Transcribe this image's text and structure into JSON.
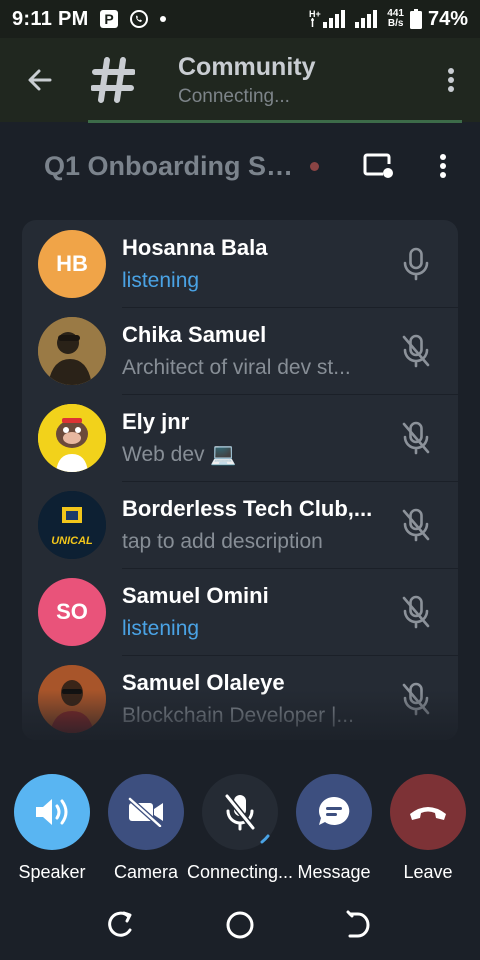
{
  "status_bar": {
    "time": "9:11 PM",
    "net_speed_value": "441",
    "net_speed_unit": "B/s",
    "battery": "74%",
    "network_type": "H+"
  },
  "header": {
    "title": "Community",
    "subtitle": "Connecting..."
  },
  "call": {
    "title": "Q1 Onboarding Se..."
  },
  "participants": [
    {
      "initials": "HB",
      "name": "Hosanna Bala",
      "desc": "listening",
      "listening": true,
      "avatar_color": "#f0a448",
      "muted": false
    },
    {
      "initials": "",
      "name": "Chika Samuel",
      "desc": "Architect of viral dev st...",
      "listening": false,
      "avatar_color": "#8a6a3a",
      "muted": true
    },
    {
      "initials": "",
      "name": "Ely jnr",
      "desc": "Web dev 💻",
      "listening": false,
      "avatar_color": "#f2d21b",
      "muted": true
    },
    {
      "initials": "",
      "name": "Borderless Tech Club,...",
      "desc": "tap to add description",
      "listening": false,
      "avatar_color": "#0d2033",
      "muted": true,
      "avatar_text": "UNICAL"
    },
    {
      "initials": "SO",
      "name": "Samuel Omini",
      "desc": "listening",
      "listening": true,
      "avatar_color": "#e9537a",
      "muted": true
    },
    {
      "initials": "",
      "name": "Samuel Olaleye",
      "desc": "Blockchain Developer |...",
      "listening": false,
      "avatar_color": "#5a3a22",
      "muted": true
    }
  ],
  "controls": {
    "speaker": "Speaker",
    "camera": "Camera",
    "mic": "Connecting...",
    "message": "Message",
    "leave": "Leave"
  },
  "colors": {
    "speaker_btn": "#59b5f2",
    "camera_btn": "#3d4f7f",
    "mic_btn": "#252b34",
    "message_btn": "#3d4f7f",
    "leave_btn": "#7d3236",
    "listening_text": "#4aa3e5"
  },
  "icons": [
    "back-arrow-icon",
    "hash-icon",
    "more-vert-icon",
    "screen-share-icon",
    "mic-icon",
    "mic-off-icon",
    "speaker-icon",
    "camera-off-icon",
    "message-icon",
    "phone-hangup-icon",
    "recents-icon",
    "home-icon",
    "back-nav-icon"
  ]
}
